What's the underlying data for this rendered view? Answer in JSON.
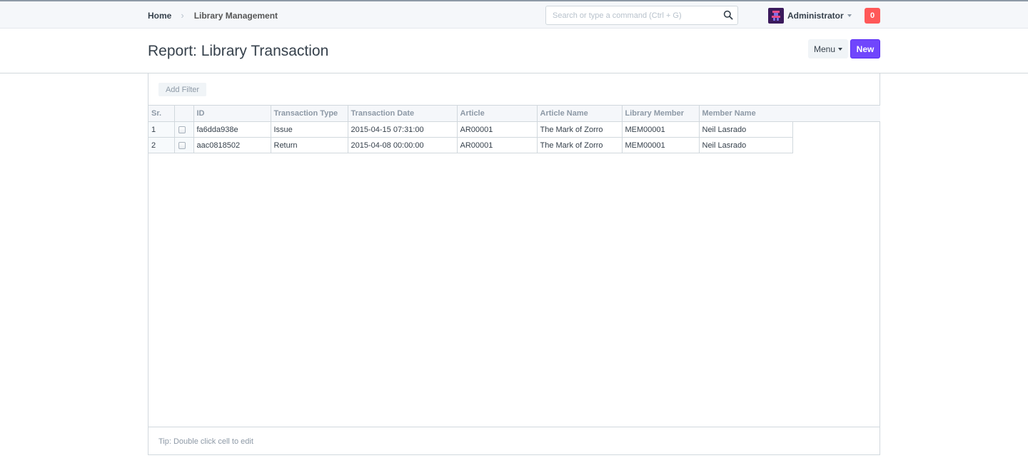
{
  "navbar": {
    "breadcrumbs": [
      "Home",
      "Library Management"
    ],
    "search_placeholder": "Search or type a command (Ctrl + G)",
    "user_name": "Administrator",
    "notification_count": "0"
  },
  "page": {
    "title": "Report: Library Transaction",
    "menu_label": "Menu",
    "new_label": "New"
  },
  "report": {
    "add_filter_label": "Add Filter",
    "columns": [
      "Sr.",
      "",
      "ID",
      "Transaction Type",
      "Transaction Date",
      "Article",
      "Article Name",
      "Library Member",
      "Member Name"
    ],
    "rows": [
      {
        "sr": "1",
        "id": "fa6dda938e",
        "transaction_type": "Issue",
        "transaction_date": "2015-04-15 07:31:00",
        "article": "AR00001",
        "article_name": "The Mark of Zorro",
        "library_member": "MEM00001",
        "member_name": "Neil Lasrado"
      },
      {
        "sr": "2",
        "id": "aac0818502",
        "transaction_type": "Return",
        "transaction_date": "2015-04-08 00:00:00",
        "article": "AR00001",
        "article_name": "The Mark of Zorro",
        "library_member": "MEM00001",
        "member_name": "Neil Lasrado"
      }
    ],
    "tip": "Tip: Double click cell to edit"
  },
  "colors": {
    "primary": "#7046fc",
    "notification": "#ff5858",
    "text": "#36414c",
    "muted": "#8d99a6"
  }
}
